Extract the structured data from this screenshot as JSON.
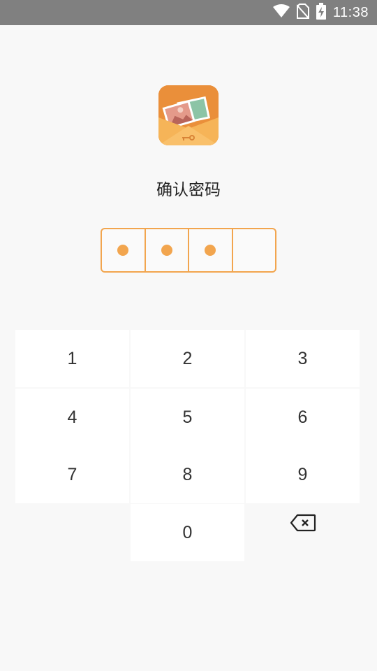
{
  "status_bar": {
    "time": "11:38",
    "icons": [
      "wifi-icon",
      "no-sim-icon",
      "battery-charging-icon"
    ]
  },
  "app": {
    "icon": "photo-envelope-lock-icon"
  },
  "title": "确认密码",
  "pin": {
    "length": 4,
    "filled": 3
  },
  "keypad": {
    "keys": [
      "1",
      "2",
      "3",
      "4",
      "5",
      "6",
      "7",
      "8",
      "9",
      "",
      "0",
      "delete-icon"
    ]
  },
  "colors": {
    "accent": "#f2a54e",
    "status_bar": "#808080",
    "background": "#f8f8f8",
    "key_background": "#ffffff"
  }
}
